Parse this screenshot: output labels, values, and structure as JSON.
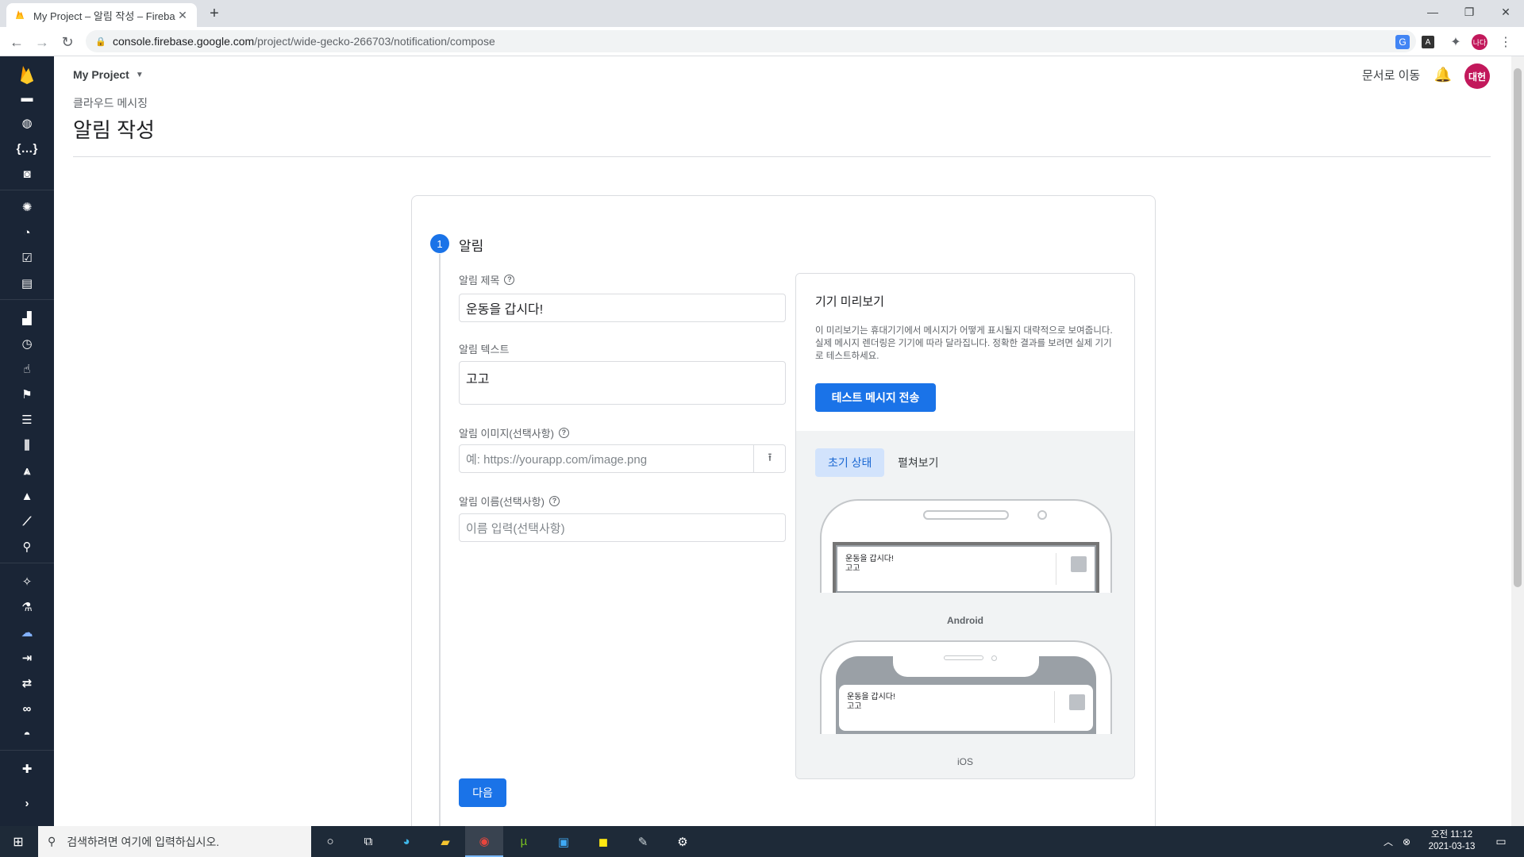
{
  "browser": {
    "tab_title": "My Project – 알림 작성 – Fireba",
    "tab_close": "✕",
    "new_tab": "+",
    "url_host": "console.firebase.google.com",
    "url_path": "/project/wide-gecko-266703/notification/compose"
  },
  "header": {
    "project_name": "My Project",
    "docs_link": "문서로 이동",
    "avatar_initials": "대헌",
    "breadcrumb": "클라우드 메시징",
    "page_title": "알림 작성"
  },
  "step": {
    "number": "1",
    "title": "알림"
  },
  "form": {
    "title_label": "알림 제목",
    "title_value": "운동을 갑시다!",
    "text_label": "알림 텍스트",
    "text_value": "고고",
    "image_label": "알림 이미지(선택사항)",
    "image_placeholder": "예: https://yourapp.com/image.png",
    "name_label": "알림 이름(선택사항)",
    "name_placeholder": "이름 입력(선택사항)",
    "next_button": "다음"
  },
  "preview": {
    "title": "기기 미리보기",
    "description": "이 미리보기는 휴대기기에서 메시지가 어떻게 표시될지 대략적으로 보여줍니다. 실제 메시지 렌더링은 기기에 따라 달라집니다. 정확한 결과를 보려면 실제 기기로 테스트하세요.",
    "send_test_button": "테스트 메시지 전송",
    "tabs": [
      {
        "label": "초기 상태",
        "active": true
      },
      {
        "label": "펼쳐보기",
        "active": false
      }
    ],
    "android_title": "운동을 갑시다!",
    "android_body": "고고",
    "android_caption": "Android",
    "ios_title": "운동을 갑시다!",
    "ios_body": "고고",
    "ios_caption": "iOS"
  },
  "taskbar": {
    "search_placeholder": "검색하려면 여기에 입력하십시오.",
    "time": "오전 11:12",
    "date": "2021-03-13"
  },
  "colors": {
    "sidebar": "#1a2536",
    "primary": "#1a73e8",
    "avatar": "#c2185b",
    "bell": "#d84315"
  },
  "sidebar_icons": [
    "storage-icon",
    "hosting-icon",
    "functions-icon",
    "ml-icon",
    "crashlytics-icon",
    "performance-icon",
    "test-lab-icon",
    "app-distribution-icon",
    "analytics-icon",
    "events-icon",
    "conversions-icon",
    "audiences-icon",
    "custom-definitions-icon",
    "latest-release-icon",
    "predictions-icon",
    "ab-testing-icon",
    "in-app-messaging-icon",
    "remote-config-icon",
    "dynamic-links-icon",
    "cloud-messaging-icon",
    "extensions-icon"
  ]
}
